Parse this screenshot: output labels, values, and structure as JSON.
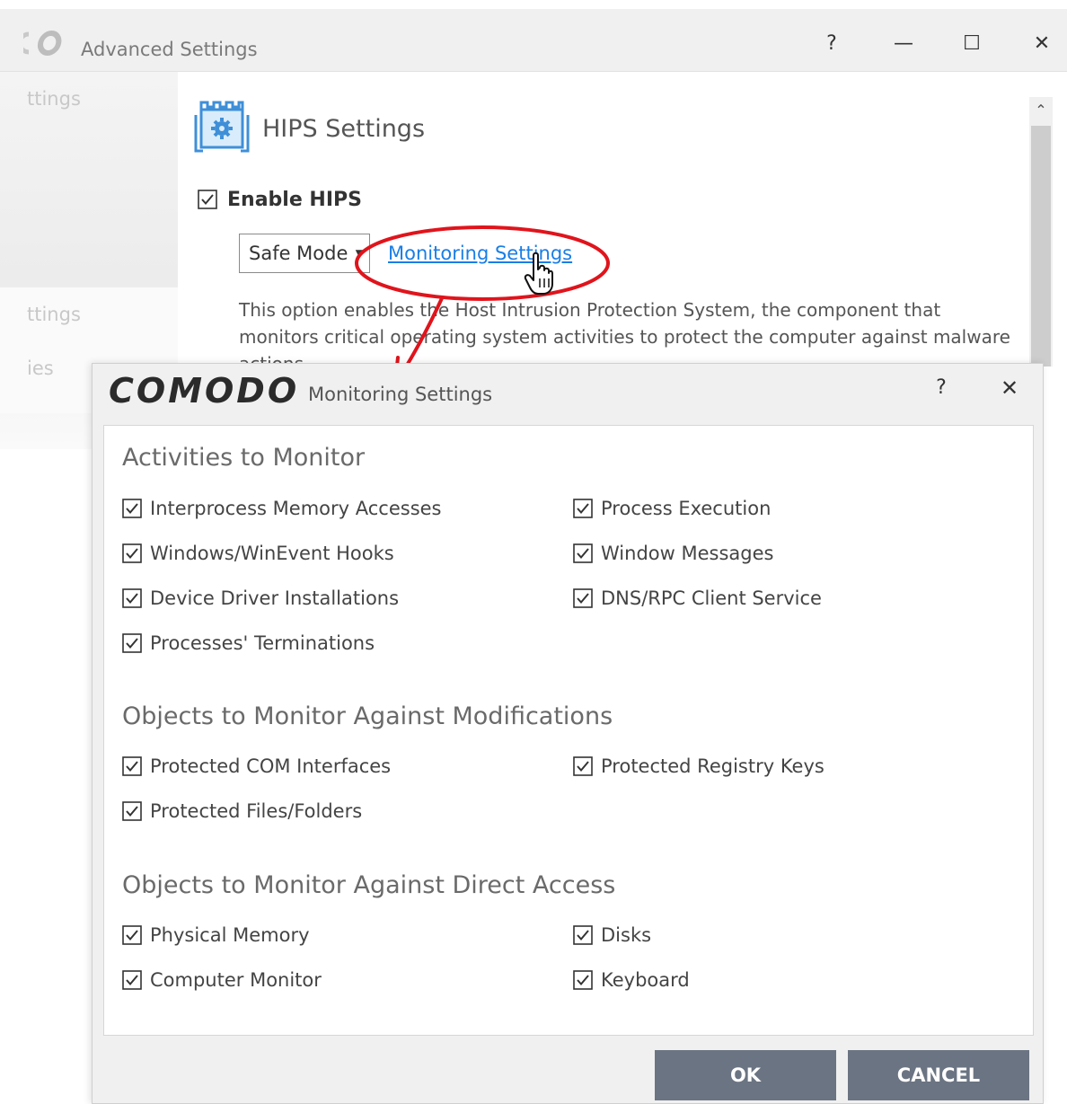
{
  "window": {
    "title": "Advanced Settings",
    "controls": {
      "help": "?",
      "minimize": "—",
      "maximize": "☐",
      "close": "✕"
    }
  },
  "sidebar": {
    "items": [
      {
        "label": "ttings"
      },
      {
        "label": "ttings"
      },
      {
        "label": "ies"
      }
    ]
  },
  "hips": {
    "title": "HIPS Settings",
    "enable_label": "Enable HIPS",
    "enable_checked": true,
    "mode_value": "Safe Mode",
    "monitoring_link": "Monitoring Settings",
    "description": "This option enables the Host Intrusion Protection System, the component that monitors critical operating system activities to protect the computer against malware actions."
  },
  "dialog": {
    "brand": "COMODO",
    "title": "Monitoring Settings",
    "help": "?",
    "close": "✕",
    "sections": [
      {
        "heading": "Activities to Monitor",
        "options": [
          {
            "label": "Interprocess Memory Accesses",
            "checked": true
          },
          {
            "label": "Process Execution",
            "checked": true
          },
          {
            "label": "Windows/WinEvent Hooks",
            "checked": true
          },
          {
            "label": "Window Messages",
            "checked": true
          },
          {
            "label": "Device Driver Installations",
            "checked": true
          },
          {
            "label": "DNS/RPC Client Service",
            "checked": true
          },
          {
            "label": "Processes' Terminations",
            "checked": true
          }
        ]
      },
      {
        "heading": "Objects to Monitor Against Modifications",
        "options": [
          {
            "label": "Protected COM Interfaces",
            "checked": true
          },
          {
            "label": "Protected Registry Keys",
            "checked": true
          },
          {
            "label": "Protected Files/Folders",
            "checked": true
          }
        ]
      },
      {
        "heading": "Objects to Monitor Against Direct Access",
        "options": [
          {
            "label": "Physical Memory",
            "checked": true
          },
          {
            "label": "Disks",
            "checked": true
          },
          {
            "label": "Computer Monitor",
            "checked": true
          },
          {
            "label": "Keyboard",
            "checked": true
          }
        ]
      }
    ],
    "ok_label": "OK",
    "cancel_label": "CANCEL"
  },
  "colors": {
    "accent_link": "#1a7ee6",
    "annotation_red": "#e0141c",
    "button_bg": "#6b7482",
    "hips_icon_blue": "#3f8fd8"
  },
  "icons": {
    "window_logo": "comodo-logo-icon",
    "hips": "hips-castle-gear-icon",
    "cursor": "hand-pointer-icon"
  }
}
